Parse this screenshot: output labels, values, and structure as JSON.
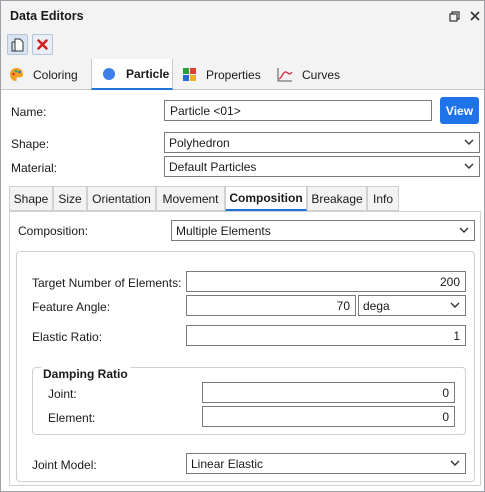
{
  "window": {
    "title": "Data Editors"
  },
  "main_tabs": [
    {
      "label": "Coloring",
      "icon": "palette-icon"
    },
    {
      "label": "Particle",
      "icon": "particle-circle-icon"
    },
    {
      "label": "Properties",
      "icon": "properties-grid-icon"
    },
    {
      "label": "Curves",
      "icon": "curve-chart-icon"
    }
  ],
  "form": {
    "name_label": "Name:",
    "name_value": "Particle <01>",
    "view_label": "View",
    "shape_label": "Shape:",
    "shape_value": "Polyhedron",
    "material_label": "Material:",
    "material_value": "Default Particles"
  },
  "sub_tabs": [
    "Shape",
    "Size",
    "Orientation",
    "Movement",
    "Composition",
    "Breakage",
    "Info"
  ],
  "composition": {
    "label": "Composition:",
    "value": "Multiple Elements",
    "target_label": "Target Number of Elements:",
    "target_value": "200",
    "feature_label": "Feature Angle:",
    "feature_value": "70",
    "feature_unit": "dega",
    "elastic_label": "Elastic Ratio:",
    "elastic_value": "1",
    "damping_title": "Damping Ratio",
    "joint_label": "Joint:",
    "joint_value": "0",
    "element_label": "Element:",
    "element_value": "0",
    "joint_model_label": "Joint Model:",
    "joint_model_value": "Linear Elastic"
  },
  "colors": {
    "accent": "#1e73e8",
    "delete": "#d11a1a"
  }
}
